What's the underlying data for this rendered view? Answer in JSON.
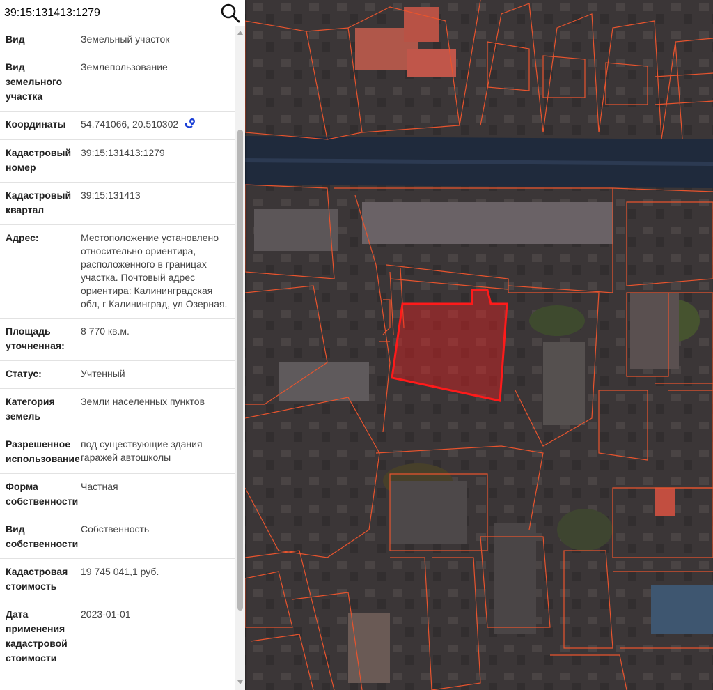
{
  "search": {
    "value": "39:15:131413:1279"
  },
  "icons": {
    "search": "search-icon",
    "coordinates_link": "route-pin-icon"
  },
  "colors": {
    "parcel_border": "#e8542e",
    "selected_parcel": "#ff1a1a",
    "link_icon": "#1a3fd6"
  },
  "details": [
    {
      "label": "Вид",
      "value": "Земельный участок"
    },
    {
      "label": "Вид земельного участка",
      "value": "Землепользование"
    },
    {
      "label": "Координаты",
      "value": "54.741066, 20.510302"
    },
    {
      "label": "Кадастровый номер",
      "value": "39:15:131413:1279"
    },
    {
      "label": "Кадастровый квартал",
      "value": "39:15:131413"
    },
    {
      "label": "Адрес:",
      "value": "Местоположение установлено относительно ориентира, расположенного в границах участка. Почтовый адрес ориентира: Калининградская обл, г Калининград, ул Озерная."
    },
    {
      "label": "Площадь уточненная:",
      "value": "8 770 кв.м."
    },
    {
      "label": "Статус:",
      "value": "Учтенный"
    },
    {
      "label": "Категория земель",
      "value": "Земли населенных пунктов"
    },
    {
      "label": "Разрешенное использование",
      "value": "под существующие здания гаражей автошколы"
    },
    {
      "label": "Форма собственности",
      "value": "Частная"
    },
    {
      "label": "Вид собственности",
      "value": "Собственность"
    },
    {
      "label": "Кадастровая стоимость",
      "value": "19 745 041,1 руб."
    },
    {
      "label": "Дата применения кадастровой стоимости",
      "value": "2023-01-01"
    }
  ]
}
